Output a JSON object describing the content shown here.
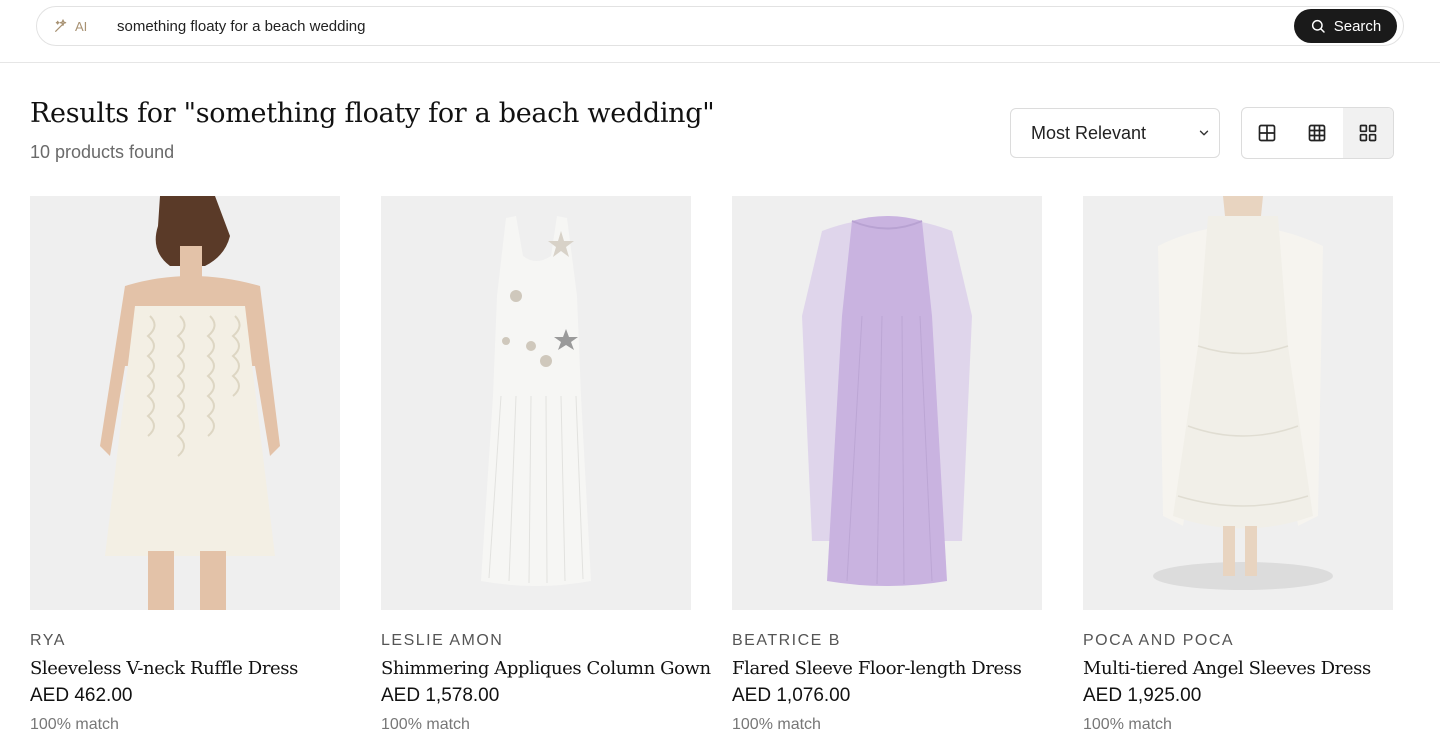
{
  "search": {
    "ai_label": "AI",
    "query": "something floaty for a beach wedding",
    "button_label": "Search"
  },
  "results": {
    "title": "Results for \"something floaty for a beach wedding\"",
    "count": "10 products found"
  },
  "sort": {
    "selected": "Most Relevant"
  },
  "view_options": [
    "grid-2-icon",
    "grid-3-icon",
    "grid-4-icon"
  ],
  "products": [
    {
      "brand": "RYA",
      "name": "Sleeveless V-neck Ruffle Dress",
      "price": "AED 462.00",
      "match": "100% match",
      "color": "#f3efe4"
    },
    {
      "brand": "LESLIE AMON",
      "name": "Shimmering Appliques Column Gown",
      "price": "AED 1,578.00",
      "match": "100% match",
      "color": "#f6f6f4"
    },
    {
      "brand": "BEATRICE B",
      "name": "Flared Sleeve Floor-length Dress",
      "price": "AED 1,076.00",
      "match": "100% match",
      "color": "#c9b3e0"
    },
    {
      "brand": "POCA AND POCA",
      "name": "Multi-tiered Angel Sleeves Dress",
      "price": "AED 1,925.00",
      "match": "100% match",
      "color": "#f1efe8"
    }
  ]
}
